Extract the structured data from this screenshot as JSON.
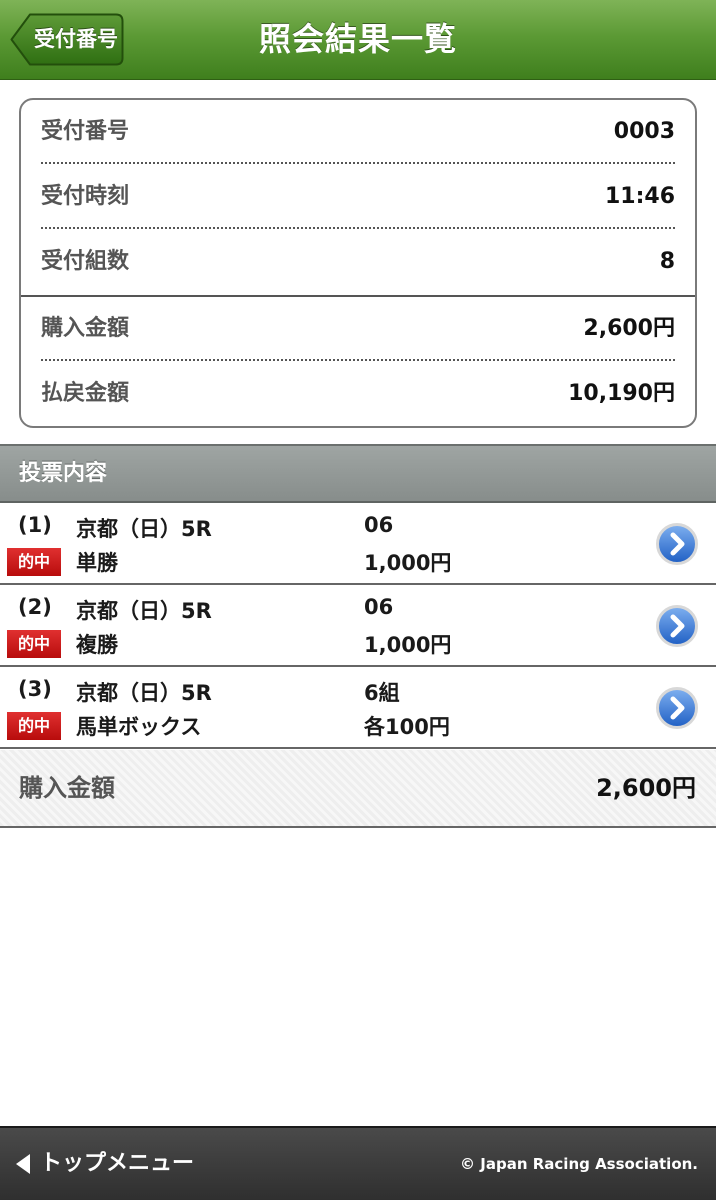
{
  "header": {
    "back_label": "受付番号",
    "title": "照会結果一覧"
  },
  "summary": {
    "rows": [
      {
        "label": "受付番号",
        "value": "0003"
      },
      {
        "label": "受付時刻",
        "value": "11:46"
      },
      {
        "label": "受付組数",
        "value": "8"
      },
      {
        "label": "購入金額",
        "value": "2,600円"
      },
      {
        "label": "払戻金額",
        "value": "10,190円"
      }
    ]
  },
  "section": {
    "label": "投票内容"
  },
  "bets": [
    {
      "number": "(1)",
      "race": "京都（日）5R",
      "badge": "的中",
      "type": "単勝",
      "line1": "06",
      "line2": "1,000円"
    },
    {
      "number": "(2)",
      "race": "京都（日）5R",
      "badge": "的中",
      "type": "複勝",
      "line1": "06",
      "line2": "1,000円"
    },
    {
      "number": "(3)",
      "race": "京都（日）5R",
      "badge": "的中",
      "type": "馬単ボックス",
      "line1": "6組",
      "line2": "各100円"
    }
  ],
  "total": {
    "label": "購入金額",
    "value": "2,600円"
  },
  "footer": {
    "top_menu_label": "トップメニュー",
    "copyright": "© Japan Racing Association."
  },
  "colors": {
    "header_green": "#5c9a35",
    "badge_red": "#c81a1a",
    "detail_blue": "#2f6fd0",
    "section_gray": "#8f9593",
    "footer_dark": "#333333"
  },
  "icons": {
    "back": "chevron-left-icon",
    "detail": "chevron-right-circle-icon",
    "top_menu": "triangle-left-icon"
  }
}
